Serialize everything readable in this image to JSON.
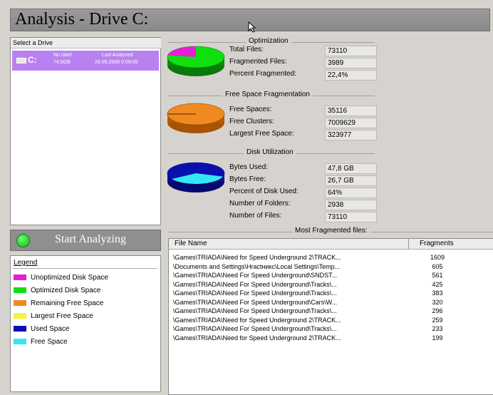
{
  "window": {
    "title": "Analysis - Drive C:"
  },
  "drive_panel": {
    "header": "Select a Drive",
    "drive": {
      "letter": "C:",
      "label": "No label",
      "size": "74,5GB",
      "last_analyzed_label": "Last Analyzed",
      "last_analyzed": "26.05.2006 0:59:00"
    }
  },
  "start_button": {
    "label": "Start Analyzing"
  },
  "legend": {
    "title": "Legend",
    "items": [
      {
        "label": "Unoptimized Disk Space",
        "color": "#e81ed3"
      },
      {
        "label": "Optimized Disk Space",
        "color": "#10e010"
      },
      {
        "label": "Remaining Free Space",
        "color": "#f08a20"
      },
      {
        "label": "Largest Free Space",
        "color": "#f4f43a"
      },
      {
        "label": "Used Space",
        "color": "#0a10b0"
      },
      {
        "label": "Free Space",
        "color": "#34e6f4"
      }
    ]
  },
  "optimization": {
    "title": "Optimization",
    "fields": [
      {
        "label": "Total Files:",
        "value": "73110"
      },
      {
        "label": "Fragmented Files:",
        "value": "3989"
      },
      {
        "label": "Percent Fragmented:",
        "value": "22,4%"
      }
    ],
    "chart": {
      "fragmented_percent": 22.4
    }
  },
  "free_space": {
    "title": "Free Space Fragmentation",
    "fields": [
      {
        "label": "Free Spaces:",
        "value": "35116"
      },
      {
        "label": "Free Clusters:",
        "value": "7009629"
      },
      {
        "label": "Largest Free Space:",
        "value": "323977"
      }
    ]
  },
  "disk_utilization": {
    "title": "Disk Utilization",
    "fields": [
      {
        "label": "Bytes Used:",
        "value": "47,8 GB"
      },
      {
        "label": "Bytes Free:",
        "value": "26,7 GB"
      },
      {
        "label": "Percent of Disk Used:",
        "value": "64%"
      },
      {
        "label": "Number of Folders:",
        "value": "2938"
      },
      {
        "label": "Number of Files:",
        "value": "73110"
      }
    ],
    "chart": {
      "used_percent": 64
    }
  },
  "most_fragmented": {
    "title": "Most Fragmented files:",
    "columns": [
      "File Name",
      "Fragments"
    ],
    "rows": [
      {
        "name": "\\Games\\TRIADA\\Need for Speed Underground 2\\TRACK...",
        "fragments": "1609"
      },
      {
        "name": "\\Documents and Settings\\Hractникс\\Local Settings\\Temp...",
        "fragments": "605"
      },
      {
        "name": "\\Games\\TRIADA\\Need For Speed Underground\\SNDST...",
        "fragments": "561"
      },
      {
        "name": "\\Games\\TRIADA\\Need For Speed Underground\\Tracks\\...",
        "fragments": "425"
      },
      {
        "name": "\\Games\\TRIADA\\Need For Speed Underground\\Tracks\\...",
        "fragments": "383"
      },
      {
        "name": "\\Games\\TRIADA\\Need For Speed Underground\\Cars\\W...",
        "fragments": "320"
      },
      {
        "name": "\\Games\\TRIADA\\Need For Speed Underground\\Tracks\\...",
        "fragments": "296"
      },
      {
        "name": "\\Games\\TRIADA\\Need for Speed Underground 2\\TRACK...",
        "fragments": "259"
      },
      {
        "name": "\\Games\\TRIADA\\Need For Speed Underground\\Tracks\\...",
        "fragments": "233"
      },
      {
        "name": "\\Games\\TRIADA\\Need for Speed Underground 2\\TRACK...",
        "fragments": "199"
      }
    ]
  }
}
